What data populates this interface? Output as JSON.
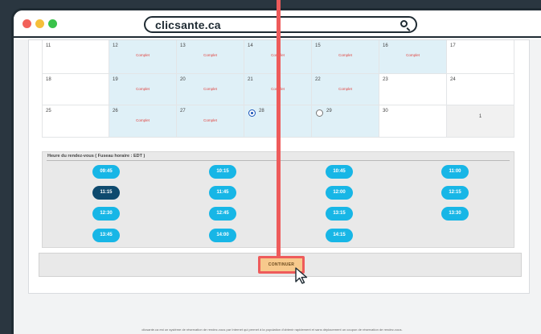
{
  "browser": {
    "url": "clicsante.ca",
    "icons": [
      "close-dot",
      "minimize-dot",
      "zoom-dot",
      "search-icon"
    ]
  },
  "calendar": {
    "rows": [
      [
        {
          "day": "11",
          "state": "plain"
        },
        {
          "day": "12",
          "state": "avail",
          "status": "Complet"
        },
        {
          "day": "13",
          "state": "avail",
          "status": "Complet"
        },
        {
          "day": "14",
          "state": "avail",
          "status": "Complet"
        },
        {
          "day": "15",
          "state": "avail",
          "status": "Complet"
        },
        {
          "day": "16",
          "state": "avail",
          "status": "Complet"
        },
        {
          "day": "17",
          "state": "plain"
        }
      ],
      [
        {
          "day": "18",
          "state": "plain"
        },
        {
          "day": "19",
          "state": "avail",
          "status": "Complet"
        },
        {
          "day": "20",
          "state": "avail",
          "status": "Complet"
        },
        {
          "day": "21",
          "state": "avail",
          "status": "Complet"
        },
        {
          "day": "22",
          "state": "avail",
          "status": "Complet"
        },
        {
          "day": "23",
          "state": "plain"
        },
        {
          "day": "24",
          "state": "plain"
        }
      ],
      [
        {
          "day": "25",
          "state": "plain"
        },
        {
          "day": "26",
          "state": "avail",
          "status": "Complet"
        },
        {
          "day": "27",
          "state": "avail",
          "status": "Complet"
        },
        {
          "day": "28",
          "state": "avail",
          "radio": "on"
        },
        {
          "day": "29",
          "state": "avail",
          "radio": "off"
        },
        {
          "day": "30",
          "state": "plain"
        },
        {
          "day": "1",
          "state": "grey"
        }
      ]
    ]
  },
  "slots": {
    "title": "Heure du rendez-vous ( Fuseau horaire : EDT )",
    "times": [
      "09:45",
      "10:15",
      "10:45",
      "11:00",
      "11:15",
      "11:45",
      "12:00",
      "12:15",
      "12:30",
      "12:45",
      "13:15",
      "13:30",
      "13:45",
      "14:00",
      "14:15"
    ],
    "selected": "11:15"
  },
  "actions": {
    "continue_label": "CONTINUER"
  },
  "footer": {
    "disclaimer": "clicsante.ca est un système de réservation de rendez-vous par Internet qui permet à la population d'obtenir rapidement et sans déplacement un coupon de réservation de rendez-vous."
  },
  "colors": {
    "accent": "#17b6e6",
    "selected_slot": "#0e4a6e",
    "complet": "#e0413d",
    "highlight": "#ee5b5b",
    "continue_bg": "#f7c98c"
  }
}
